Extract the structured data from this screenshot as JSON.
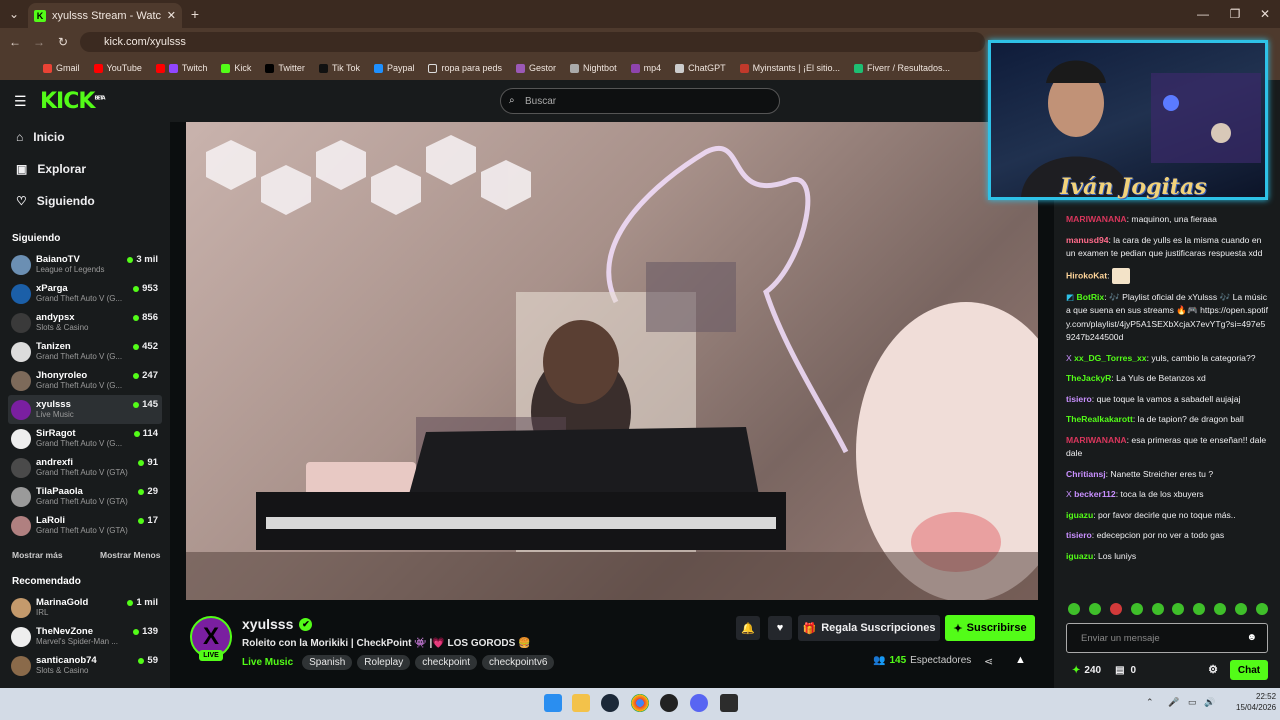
{
  "browser": {
    "tab_title": "xyulsss Stream - Watch Live on",
    "url": "kick.com/xyulsss",
    "bookmarks": [
      "Gmail",
      "YouTube",
      "Twitch",
      "Kick",
      "Twitter",
      "Tik Tok",
      "Paypal",
      "ropa para peds",
      "Gestor",
      "Nightbot",
      "mp4",
      "ChatGPT",
      "Myinstants | ¡El sitio...",
      "Fiverr / Resultados..."
    ]
  },
  "header": {
    "logo": "KICK",
    "logo_sup": "BETA",
    "search_placeholder": "Buscar"
  },
  "sidebar": {
    "nav": [
      {
        "label": "Inicio",
        "icon": "home-icon"
      },
      {
        "label": "Explorar",
        "icon": "compass-icon"
      },
      {
        "label": "Siguiendo",
        "icon": "heart-icon"
      }
    ],
    "following_title": "Siguiendo",
    "following": [
      {
        "name": "BaianoTV",
        "game": "League of Legends",
        "viewers": "3 mil"
      },
      {
        "name": "xParga",
        "game": "Grand Theft Auto V (G...",
        "viewers": "953"
      },
      {
        "name": "andypsx",
        "game": "Slots & Casino",
        "viewers": "856"
      },
      {
        "name": "Tanizen",
        "game": "Grand Theft Auto V (G...",
        "viewers": "452"
      },
      {
        "name": "Jhonyroleo",
        "game": "Grand Theft Auto V (G...",
        "viewers": "247"
      },
      {
        "name": "xyulsss",
        "game": "Live Music",
        "viewers": "145"
      },
      {
        "name": "SirRagot",
        "game": "Grand Theft Auto V (G...",
        "viewers": "114"
      },
      {
        "name": "andrexfi",
        "game": "Grand Theft Auto V (GTA)",
        "viewers": "91"
      },
      {
        "name": "TilaPaaola",
        "game": "Grand Theft Auto V (GTA)",
        "viewers": "29"
      },
      {
        "name": "LaRoli",
        "game": "Grand Theft Auto V (GTA)",
        "viewers": "17"
      }
    ],
    "show_more": "Mostrar más",
    "show_less": "Mostrar Menos",
    "recommended_title": "Recomendado",
    "recommended": [
      {
        "name": "MarinaGold",
        "game": "IRL",
        "viewers": "1 mil"
      },
      {
        "name": "TheNevZone",
        "game": "Marvel's Spider-Man ...",
        "viewers": "139"
      },
      {
        "name": "santicanob74",
        "game": "Slots & Casino",
        "viewers": "59"
      }
    ]
  },
  "channel": {
    "name": "xyulsss",
    "live": "LIVE",
    "title": "Roleito con la Morikiki | CheckPoint 👾 |💗 LOS GORODS 🍔",
    "category": "Live Music",
    "tags": [
      "Spanish",
      "Roleplay",
      "checkpoint",
      "checkpointv6"
    ],
    "gift_label": "Regala Suscripciones",
    "subscribe_label": "Suscribirse",
    "viewers": "145",
    "viewers_label": "Espectadores"
  },
  "facecam": {
    "name": "Iván Jogitas"
  },
  "chat": {
    "messages": [
      {
        "user": "MARIWANANA",
        "color": "#d9365c",
        "text": "maquinon, una fieraaa"
      },
      {
        "user": "manusd94",
        "color": "#ff6b8a",
        "text": "la cara de yulls es la misma cuando en un examen te pedian que justificaras respuesta xdd"
      },
      {
        "user": "HirokoKat",
        "color": "#ffd59a",
        "text": ""
      },
      {
        "user": "BotRix",
        "color": "#53fc18",
        "text": "🎶 Playlist oficial de xYulsss 🎶 La música que suena en sus streams 🔥🎮 https://open.spotify.com/playlist/4jyP5A1SEXbXcjaX7evYTg?si=497e59247b244500d"
      },
      {
        "user": "xx_DG_Torres_xx",
        "color": "#53fc18",
        "text": "yuls, cambio la categoria??"
      },
      {
        "user": "TheJackyR",
        "color": "#53fc18",
        "text": "La Yuls de Betanzos xd"
      },
      {
        "user": "tisiero",
        "color": "#c990ff",
        "text": "que toque la vamos a sabadell aujajaj"
      },
      {
        "user": "TheRealkakarott",
        "color": "#53fc18",
        "text": "la de tapion? de dragon ball"
      },
      {
        "user": "MARIWANANA",
        "color": "#d9365c",
        "text": "esa primeras que te enseñan!! dale dale"
      },
      {
        "user": "Chritiansj",
        "color": "#c990ff",
        "text": "Nanette Streicher eres tu ?"
      },
      {
        "user": "becker112",
        "color": "#c990ff",
        "text": "toca la de los xbuyers"
      },
      {
        "user": "iguazu",
        "color": "#53fc18",
        "text": "por favor decirle que no toque más.."
      },
      {
        "user": "tisiero",
        "color": "#c990ff",
        "text": "edecepcion por no ver a todo gas"
      },
      {
        "user": "iguazu",
        "color": "#53fc18",
        "text": "Los luniys"
      }
    ],
    "input_placeholder": "Enviar un mensaje",
    "points": "240",
    "zero": "0",
    "chat_button": "Chat"
  },
  "taskbar": {
    "time": "22:52",
    "date": "15/04/2026"
  }
}
